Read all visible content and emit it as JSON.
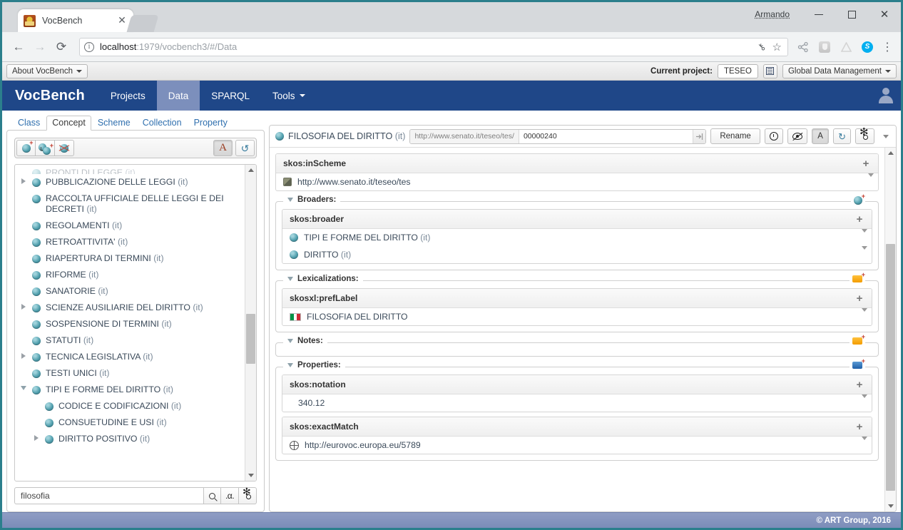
{
  "browser": {
    "tab_title": "VocBench",
    "tab_favicon": "vocbench-favicon",
    "close_label": "✕",
    "user_label": "Armando",
    "back_label": "←",
    "forward_label": "→",
    "reload_label": "⟳",
    "url_prefix": "localhost",
    "url_rest": ":1979/vocbench3/#/Data",
    "star_label": "☆",
    "key_label": "⚷",
    "menu_label": "⋮"
  },
  "topstrip": {
    "about_label": "About VocBench",
    "current_project_label": "Current project:",
    "project_name": "TESEO",
    "role_label": "Global Data Management"
  },
  "navbar": {
    "brand": "VocBench",
    "items": [
      {
        "label": "Projects",
        "active": false,
        "caret": false
      },
      {
        "label": "Data",
        "active": true,
        "caret": false
      },
      {
        "label": "SPARQL",
        "active": false,
        "caret": false
      },
      {
        "label": "Tools",
        "active": false,
        "caret": true
      }
    ]
  },
  "left": {
    "tabs": [
      {
        "label": "Class",
        "active": false
      },
      {
        "label": "Concept",
        "active": true
      },
      {
        "label": "Scheme",
        "active": false
      },
      {
        "label": "Collection",
        "active": false
      },
      {
        "label": "Property",
        "active": false
      }
    ],
    "toolbar": {
      "create_concept": "create-concept-icon",
      "create_narrower": "create-narrower-icon",
      "delete_concept": "delete-concept-icon",
      "show_labels": "A",
      "refresh": "↺"
    },
    "tree": [
      {
        "label": "PUBBLICAZIONE DELLE LEGGI",
        "lang": "(it)",
        "arrow": "right",
        "indent": 0
      },
      {
        "label": "RACCOLTA UFFICIALE DELLE LEGGI E DEI DECRETI",
        "lang": "(it)",
        "arrow": "none",
        "indent": 0
      },
      {
        "label": "REGOLAMENTI",
        "lang": "(it)",
        "arrow": "none",
        "indent": 0
      },
      {
        "label": "RETROATTIVITA'",
        "lang": "(it)",
        "arrow": "none",
        "indent": 0
      },
      {
        "label": "RIAPERTURA DI TERMINI",
        "lang": "(it)",
        "arrow": "none",
        "indent": 0
      },
      {
        "label": "RIFORME",
        "lang": "(it)",
        "arrow": "none",
        "indent": 0
      },
      {
        "label": "SANATORIE",
        "lang": "(it)",
        "arrow": "none",
        "indent": 0
      },
      {
        "label": "SCIENZE AUSILIARIE DEL DIRITTO",
        "lang": "(it)",
        "arrow": "right",
        "indent": 0
      },
      {
        "label": "SOSPENSIONE DI TERMINI",
        "lang": "(it)",
        "arrow": "none",
        "indent": 0
      },
      {
        "label": "STATUTI",
        "lang": "(it)",
        "arrow": "none",
        "indent": 0
      },
      {
        "label": "TECNICA LEGISLATIVA",
        "lang": "(it)",
        "arrow": "right",
        "indent": 0
      },
      {
        "label": "TESTI UNICI",
        "lang": "(it)",
        "arrow": "none",
        "indent": 0
      },
      {
        "label": "TIPI E FORME DEL DIRITTO",
        "lang": "(it)",
        "arrow": "down",
        "indent": 0
      },
      {
        "label": "CODICE E CODIFICAZIONI",
        "lang": "(it)",
        "arrow": "none",
        "indent": 1
      },
      {
        "label": "CONSUETUDINE E USI",
        "lang": "(it)",
        "arrow": "none",
        "indent": 1
      },
      {
        "label": "DIRITTO POSITIVO",
        "lang": "(it)",
        "arrow": "right",
        "indent": 1
      }
    ],
    "search": {
      "value": "filosofia",
      "placeholder": "",
      "search_icon": "magnifier-icon",
      "alpha_label": ".α.",
      "settings_icon": "gear-icon"
    }
  },
  "resource": {
    "title": "FILOSOFIA DEL DIRITTO",
    "title_lang": "(it)",
    "uri_prefix": "http://www.senato.it/teseo/tes/",
    "uri_local": "00000240",
    "rename_label": "Rename",
    "buttons": {
      "history": "clock-icon",
      "validation": "eye-slash-icon",
      "labels": "A",
      "refresh": "refresh-icon",
      "settings": "gear-icon",
      "more": "chevron-down-icon"
    },
    "sections": [
      {
        "kind": "plain",
        "blocks": [
          {
            "property": "skos:inScheme",
            "add_label": "+",
            "rows": [
              {
                "icon": "scheme-icon",
                "value": "http://www.senato.it/teseo/tes",
                "caret": true
              }
            ]
          }
        ]
      },
      {
        "kind": "fieldset",
        "legend": "Broaders:",
        "badge": "concept-add",
        "blocks": [
          {
            "property": "skos:broader",
            "add_label": "+",
            "rows": [
              {
                "icon": "concept-icon",
                "value": "TIPI E FORME DEL DIRITTO",
                "lang": "(it)",
                "caret": true
              },
              {
                "icon": "concept-icon",
                "value": "DIRITTO",
                "lang": "(it)",
                "caret": true
              }
            ]
          }
        ]
      },
      {
        "kind": "fieldset",
        "legend": "Lexicalizations:",
        "badge": "orange-add",
        "blocks": [
          {
            "property": "skosxl:prefLabel",
            "add_label": "+",
            "rows": [
              {
                "icon": "italian-flag-icon",
                "value": "FILOSOFIA DEL DIRITTO",
                "caret": true
              }
            ]
          }
        ]
      },
      {
        "kind": "fieldset",
        "legend": "Notes:",
        "badge": "orange-add",
        "blocks": []
      },
      {
        "kind": "fieldset",
        "legend": "Properties:",
        "badge": "blue-add",
        "blocks": [
          {
            "property": "skos:notation",
            "add_label": "+",
            "rows": [
              {
                "icon": "none",
                "value": "340.12",
                "caret": true
              }
            ]
          },
          {
            "property": "skos:exactMatch",
            "add_label": "+",
            "rows": [
              {
                "icon": "globe-icon",
                "value": "http://eurovoc.europa.eu/5789",
                "caret": true
              }
            ]
          }
        ]
      }
    ]
  },
  "footer": {
    "copyright": "© ART Group, 2016"
  },
  "colors": {
    "navbar": "#1f4788",
    "navbar_active": "#7c8fbc",
    "window_border": "#2b7f8c",
    "footer": "#7b8cb8",
    "tab_link": "#2f6fae",
    "node": "#52a0ae"
  }
}
